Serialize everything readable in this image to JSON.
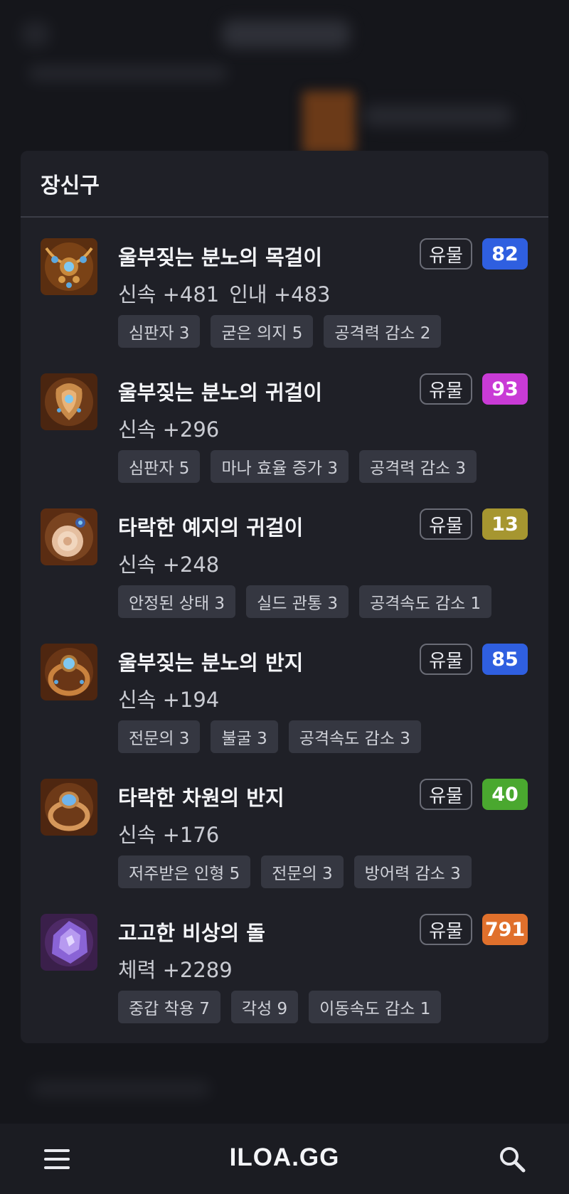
{
  "panel": {
    "title": "장신구",
    "items": [
      {
        "name": "울부짖는 분노의 목걸이",
        "stats": [
          "신속 +481",
          "인내 +483"
        ],
        "grade": "유물",
        "quality": "82",
        "quality_color": "#2f5fe0",
        "icon": "necklace-icon",
        "tags": [
          "심판자 3",
          "굳은 의지 5",
          "공격력 감소 2"
        ]
      },
      {
        "name": "울부짖는 분노의 귀걸이",
        "stats": [
          "신속 +296"
        ],
        "grade": "유물",
        "quality": "93",
        "quality_color": "#c93bd6",
        "icon": "earring-icon",
        "tags": [
          "심판자 5",
          "마나 효율 증가 3",
          "공격력 감소 3"
        ]
      },
      {
        "name": "타락한 예지의 귀걸이",
        "stats": [
          "신속 +248"
        ],
        "grade": "유물",
        "quality": "13",
        "quality_color": "#a69630",
        "icon": "earring-icon",
        "tags": [
          "안정된 상태 3",
          "실드 관통 3",
          "공격속도 감소 1"
        ]
      },
      {
        "name": "울부짖는 분노의 반지",
        "stats": [
          "신속 +194"
        ],
        "grade": "유물",
        "quality": "85",
        "quality_color": "#2f5fe0",
        "icon": "ring-icon",
        "tags": [
          "전문의 3",
          "불굴 3",
          "공격속도 감소 3"
        ]
      },
      {
        "name": "타락한 차원의 반지",
        "stats": [
          "신속 +176"
        ],
        "grade": "유물",
        "quality": "40",
        "quality_color": "#4aa82f",
        "icon": "ring-icon",
        "tags": [
          "저주받은 인형 5",
          "전문의 3",
          "방어력 감소 3"
        ]
      },
      {
        "name": "고고한 비상의 돌",
        "stats": [
          "체력 +2289"
        ],
        "grade": "유물",
        "quality": "791",
        "quality_color": "#e0702c",
        "icon": "ability-stone-icon",
        "tags": [
          "중갑 착용 7",
          "각성 9",
          "이동속도 감소 1"
        ]
      }
    ]
  },
  "bottom_bar": {
    "logo": "ILOA.GG",
    "menu_icon": "hamburger-menu-icon",
    "search_icon": "search-icon"
  }
}
